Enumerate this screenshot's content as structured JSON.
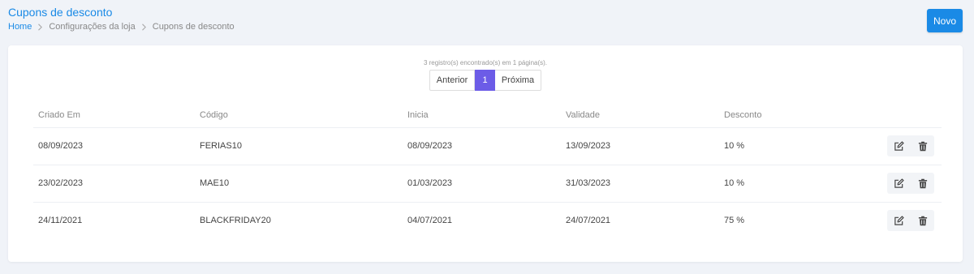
{
  "header": {
    "title": "Cupons de desconto",
    "breadcrumb": [
      "Home",
      "Configurações da loja",
      "Cupons de desconto"
    ],
    "new_button": "Novo"
  },
  "pagination": {
    "records_text": "3 registro(s) encontrado(s) em 1 página(s).",
    "prev": "Anterior",
    "current": "1",
    "next": "Próxima"
  },
  "table": {
    "columns": [
      "Criado Em",
      "Código",
      "Inicia",
      "Validade",
      "Desconto"
    ],
    "rows": [
      {
        "created": "08/09/2023",
        "code": "FERIAS10",
        "start": "08/09/2023",
        "valid": "13/09/2023",
        "discount": "10 %"
      },
      {
        "created": "23/02/2023",
        "code": "MAE10",
        "start": "01/03/2023",
        "valid": "31/03/2023",
        "discount": "10 %"
      },
      {
        "created": "24/11/2021",
        "code": "BLACKFRIDAY20",
        "start": "04/07/2021",
        "valid": "24/07/2021",
        "discount": "75 %"
      }
    ]
  },
  "icons": {
    "edit": "edit-icon",
    "delete": "trash-icon"
  },
  "colors": {
    "primary": "#1a8ae6",
    "page_active": "#6c5ce7",
    "background": "#f0f3f8"
  }
}
